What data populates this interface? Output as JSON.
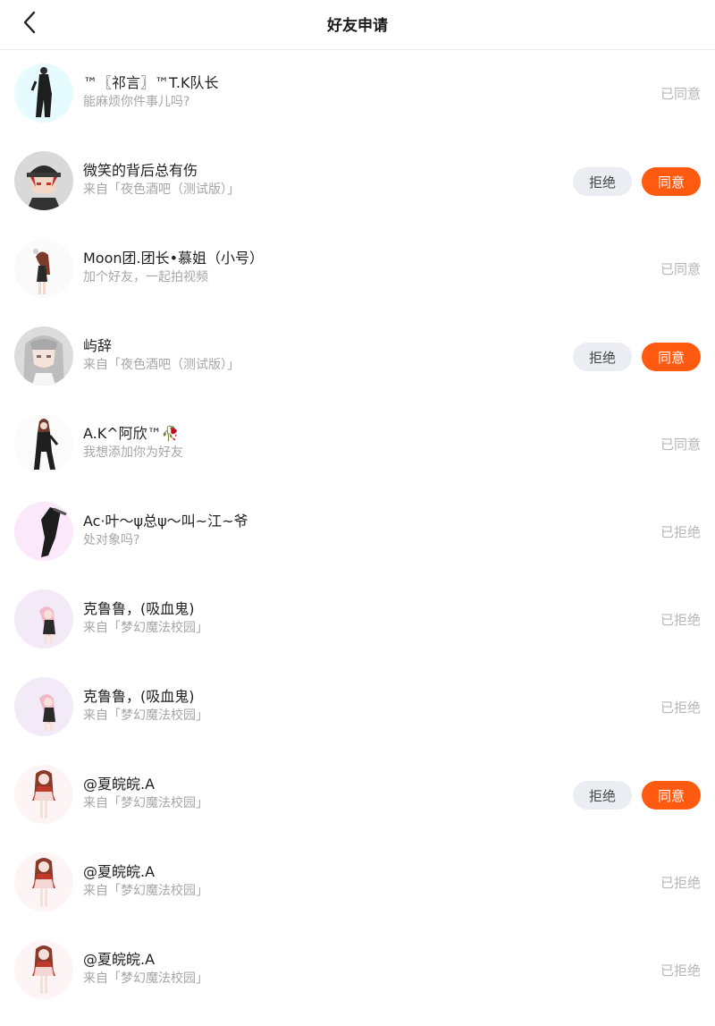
{
  "header": {
    "title": "好友申请"
  },
  "colors": {
    "accent": "#ff5a10",
    "reject_bg": "#ebedf2",
    "muted": "#b5b5b5"
  },
  "actions": {
    "reject": "拒绝",
    "agree": "同意"
  },
  "requests": [
    {
      "name": "™〖祁言〗™T.K队长",
      "message": "能麻烦你件事儿吗?",
      "status": "已同意",
      "pending": false,
      "avatar": "dark-figure-cyan"
    },
    {
      "name": "微笑的背后总有伤",
      "message": "来自「夜色酒吧（测试版）」",
      "status": "",
      "pending": true,
      "avatar": "anime-boy-cap"
    },
    {
      "name": "Moon团.团长•慕姐（小号）",
      "message": "加个好友，一起拍视频",
      "status": "已同意",
      "pending": false,
      "avatar": "girl-white-bg"
    },
    {
      "name": "屿辞",
      "message": "来自「夜色酒吧（测试版）」",
      "status": "",
      "pending": true,
      "avatar": "anime-girl-silver"
    },
    {
      "name": "A.K^阿欣™🥀",
      "message": "我想添加你为好友",
      "status": "已同意",
      "pending": false,
      "avatar": "dark-figure-white"
    },
    {
      "name": "Ac·叶〜ψ总ψ〜叫~江~爷",
      "message": "处对象吗?",
      "status": "已拒绝",
      "pending": false,
      "avatar": "legs-pink"
    },
    {
      "name": "克鲁鲁，(吸血鬼)",
      "message": "来自「梦幻魔法校园」",
      "status": "已拒绝",
      "pending": false,
      "avatar": "pink-girl"
    },
    {
      "name": "克鲁鲁，(吸血鬼)",
      "message": "来自「梦幻魔法校园」",
      "status": "已拒绝",
      "pending": false,
      "avatar": "pink-girl"
    },
    {
      "name": "@夏皖皖.A",
      "message": "来自「梦幻魔法校园」",
      "status": "",
      "pending": true,
      "avatar": "maid-girl"
    },
    {
      "name": "@夏皖皖.A",
      "message": "来自「梦幻魔法校园」",
      "status": "已拒绝",
      "pending": false,
      "avatar": "maid-girl"
    },
    {
      "name": "@夏皖皖.A",
      "message": "来自「梦幻魔法校园」",
      "status": "已拒绝",
      "pending": false,
      "avatar": "maid-girl"
    }
  ]
}
